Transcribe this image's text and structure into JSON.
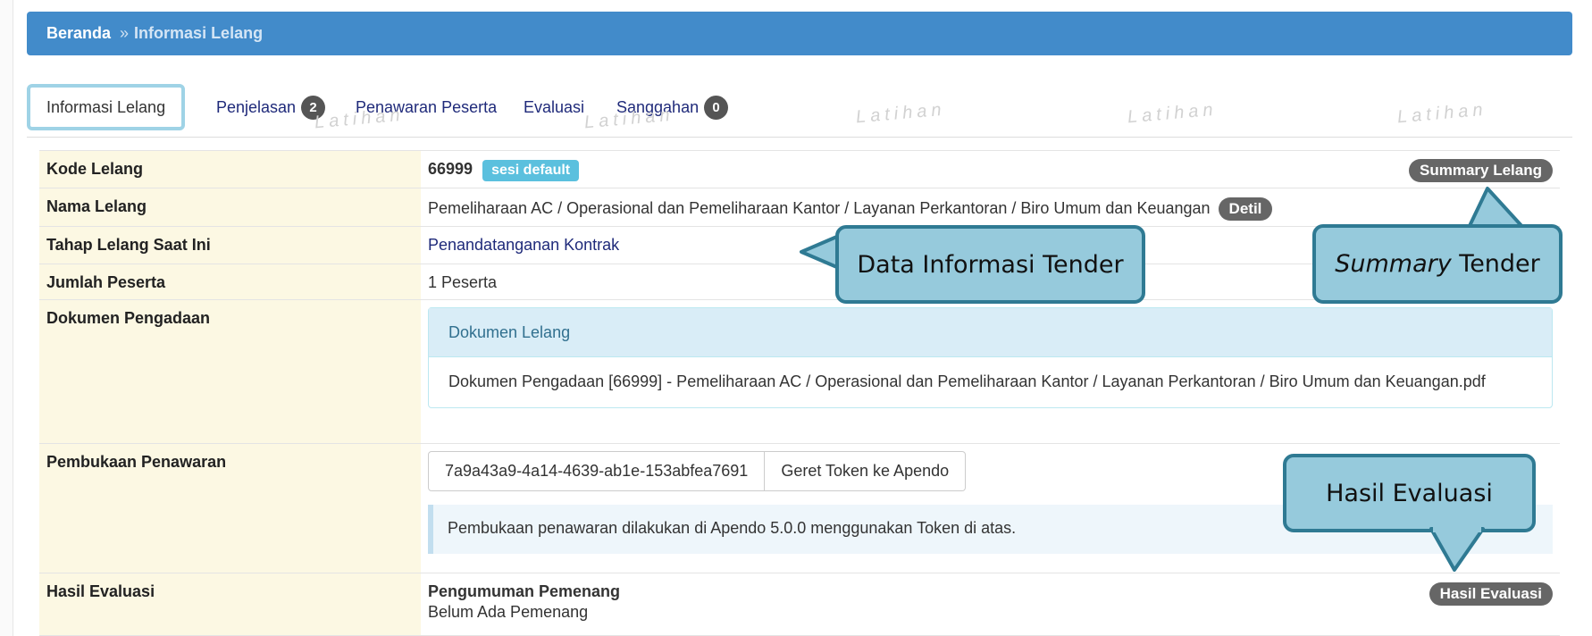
{
  "breadcrumb": {
    "home": "Beranda",
    "separator": "»",
    "current": "Informasi Lelang"
  },
  "tabs": [
    {
      "label": "Informasi Lelang"
    },
    {
      "label": "Penjelasan",
      "badge": "2"
    },
    {
      "label": "Penawaran Peserta"
    },
    {
      "label": "Evaluasi"
    },
    {
      "label": "Sanggahan",
      "badge": "0"
    }
  ],
  "watermark": "Latihan",
  "rows": {
    "kode": {
      "label": "Kode Lelang",
      "value": "66999",
      "tag": "sesi default",
      "summary_button": "Summary Lelang"
    },
    "nama": {
      "label": "Nama Lelang",
      "value": "Pemeliharaan AC / Operasional dan Pemeliharaan Kantor / Layanan Perkantoran / Biro Umum dan Keuangan",
      "detail_button": "Detil"
    },
    "tahap": {
      "label": "Tahap Lelang Saat Ini",
      "value": "Penandatanganan Kontrak"
    },
    "jumlah": {
      "label": "Jumlah Peserta",
      "value": "1 Peserta"
    },
    "dokumen": {
      "label": "Dokumen Pengadaan",
      "panel_title": "Dokumen Lelang",
      "file": "Dokumen Pengadaan [66999] - Pemeliharaan AC / Operasional dan Pemeliharaan Kantor / Layanan Perkantoran / Biro Umum dan Keuangan.pdf"
    },
    "pembukaan": {
      "label": "Pembukaan Penawaran",
      "token": "7a9a43a9-4a14-4639-ab1e-153abfea7691",
      "token_button": "Geret Token ke Apendo",
      "note": "Pembukaan penawaran dilakukan di Apendo 5.0.0 menggunakan Token di atas."
    },
    "hasil": {
      "label": "Hasil Evaluasi",
      "title": "Pengumuman Pemenang",
      "status": "Belum Ada Pemenang",
      "button": "Hasil Evaluasi"
    }
  },
  "callouts": {
    "data_info": "Data Informasi Tender",
    "summary_italic": "Summary",
    "summary_rest": " Tender",
    "hasil": "Hasil Evaluasi"
  },
  "colors": {
    "header": "#428bca",
    "label_bg": "#fcf8e3",
    "callout_fill": "#96cadc",
    "callout_border": "#2f7a93",
    "tag": "#5bc0de"
  }
}
